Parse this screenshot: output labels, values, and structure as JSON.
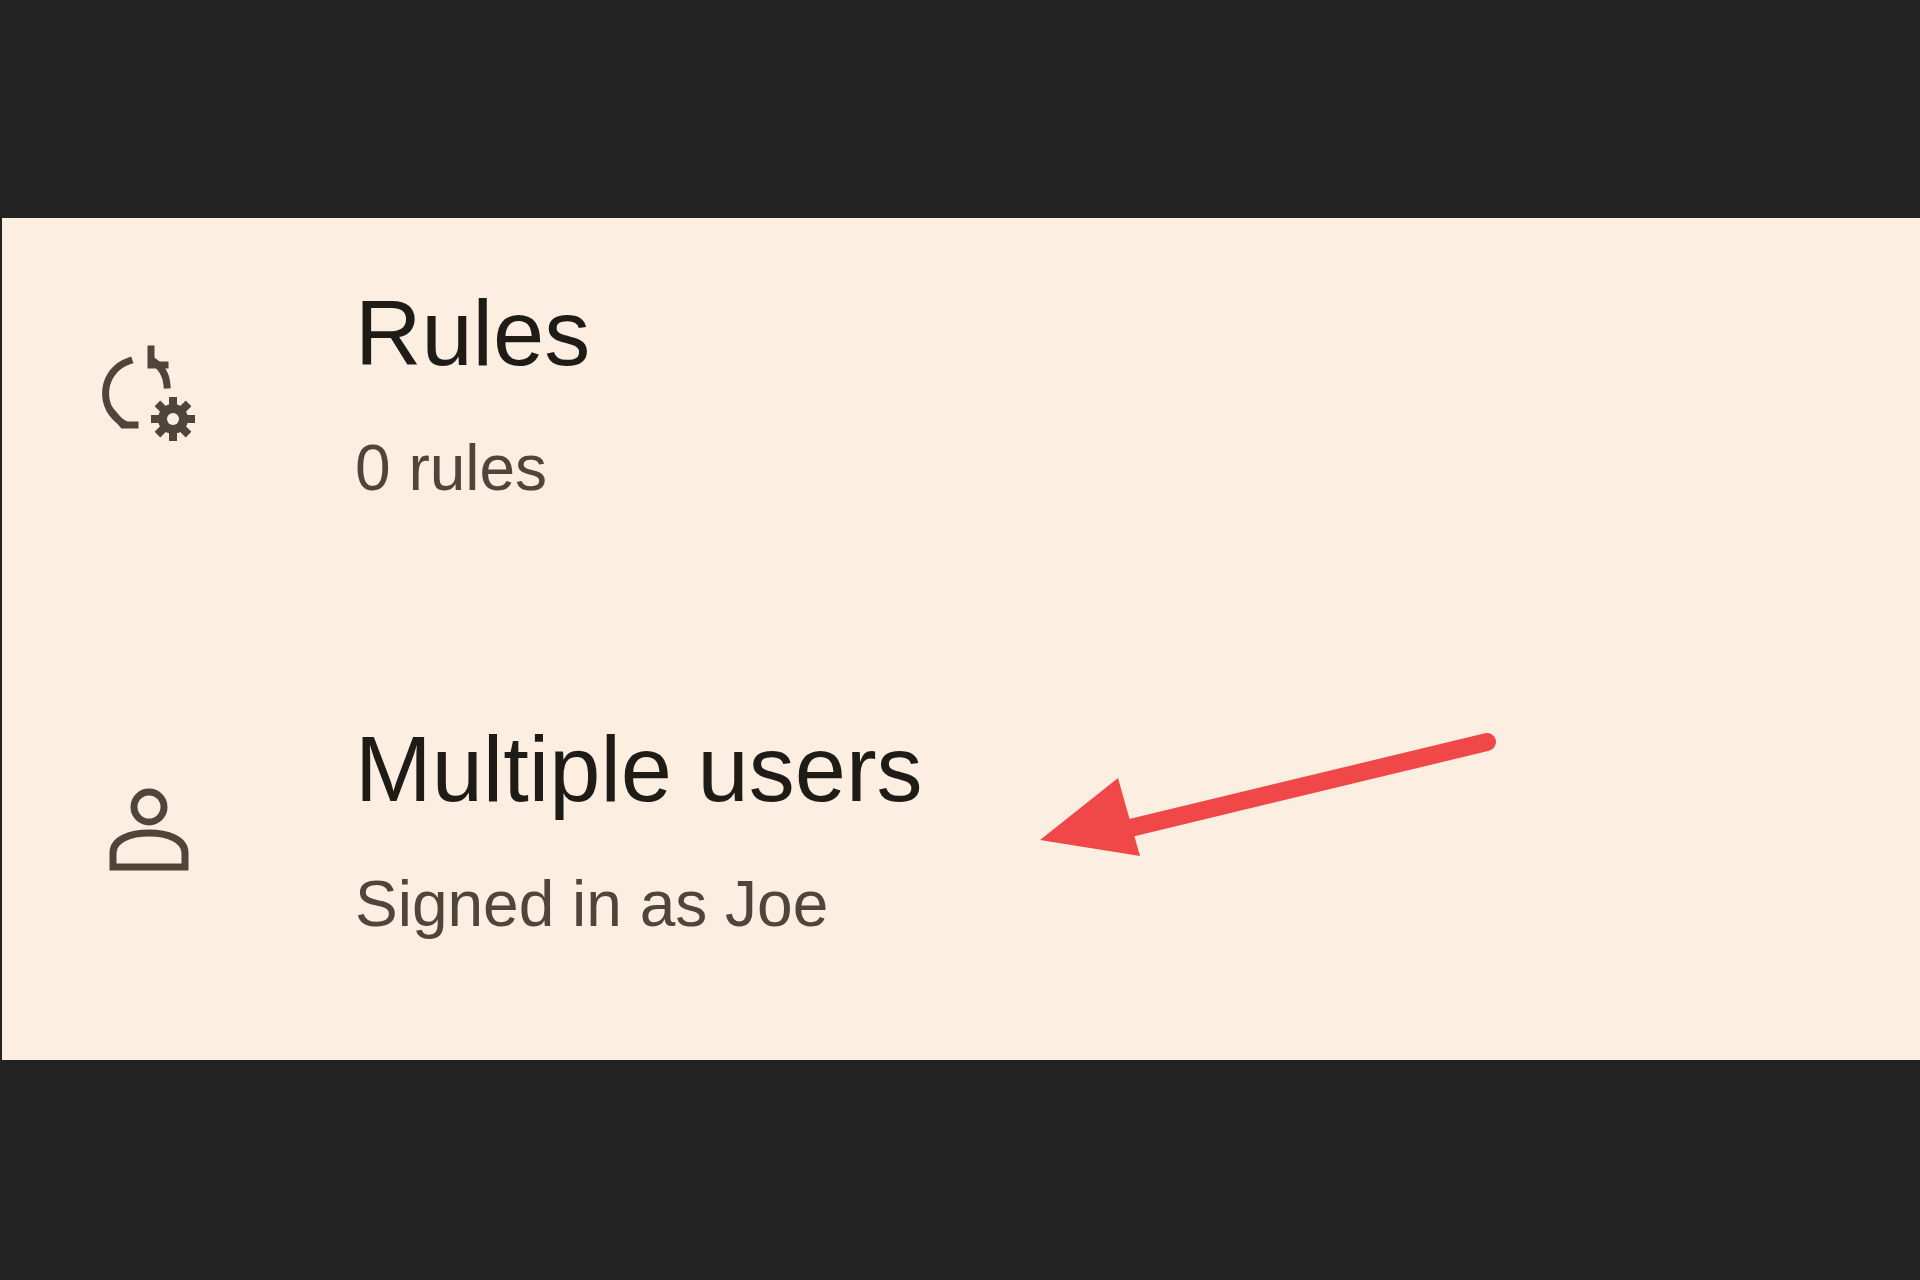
{
  "settings_items": [
    {
      "kind": "rules",
      "title": "Rules",
      "subtitle": "0 rules"
    },
    {
      "kind": "users",
      "title": "Multiple users",
      "subtitle": "Signed in as Joe"
    }
  ]
}
